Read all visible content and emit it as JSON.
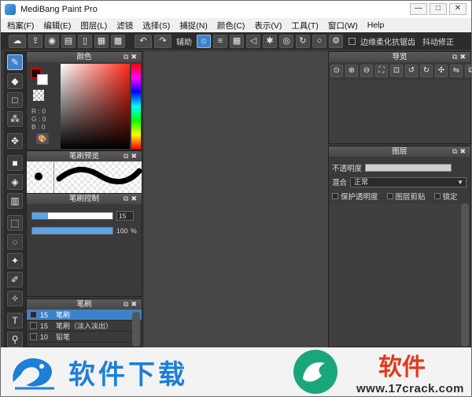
{
  "window": {
    "title": "MediBang Paint Pro",
    "buttons": [
      "—",
      "□",
      "✕"
    ]
  },
  "menu": [
    "档案(F)",
    "编辑(E)",
    "图层(L)",
    "滤镜",
    "选择(S)",
    "捕捉(N)",
    "颜色(C)",
    "表示(V)",
    "工具(T)",
    "窗口(W)",
    "Help"
  ],
  "toolbar": {
    "snap_label": "辅助",
    "antialias_label": "边缘柔化抗锯齿",
    "stabilizer_label": "抖动修正"
  },
  "panels": {
    "color": {
      "title": "颜色",
      "rgb": [
        "R : 0",
        "G : 0",
        "B : 0"
      ],
      "fg_color": "#1a0000",
      "hue_color": "#ff2a1a"
    },
    "brush_preview": {
      "title": "笔刷预览"
    },
    "brush_control": {
      "title": "笔刷控制",
      "size_value": "15",
      "size_fraction": 0.2,
      "opacity_value": "100",
      "opacity_unit": "%",
      "opacity_fraction": 1.0
    },
    "brush": {
      "title": "笔刷",
      "items": [
        {
          "size": "15",
          "name": "笔刷",
          "selected": true
        },
        {
          "size": "15",
          "name": "笔刷（淡入淡出）",
          "selected": false
        },
        {
          "size": "10",
          "name": "铅笔",
          "selected": false
        }
      ]
    },
    "navigator": {
      "title": "导览"
    },
    "layers": {
      "title": "图层",
      "opacity_label": "不透明度",
      "blend_label": "混合",
      "blend_value": "正常",
      "protect_alpha": "保护透明度",
      "clipping": "图层剪贴",
      "lock": "锁定"
    }
  },
  "watermark": {
    "text_left": "软件下载",
    "text_right": "软件",
    "url": "www.17crack.com"
  }
}
